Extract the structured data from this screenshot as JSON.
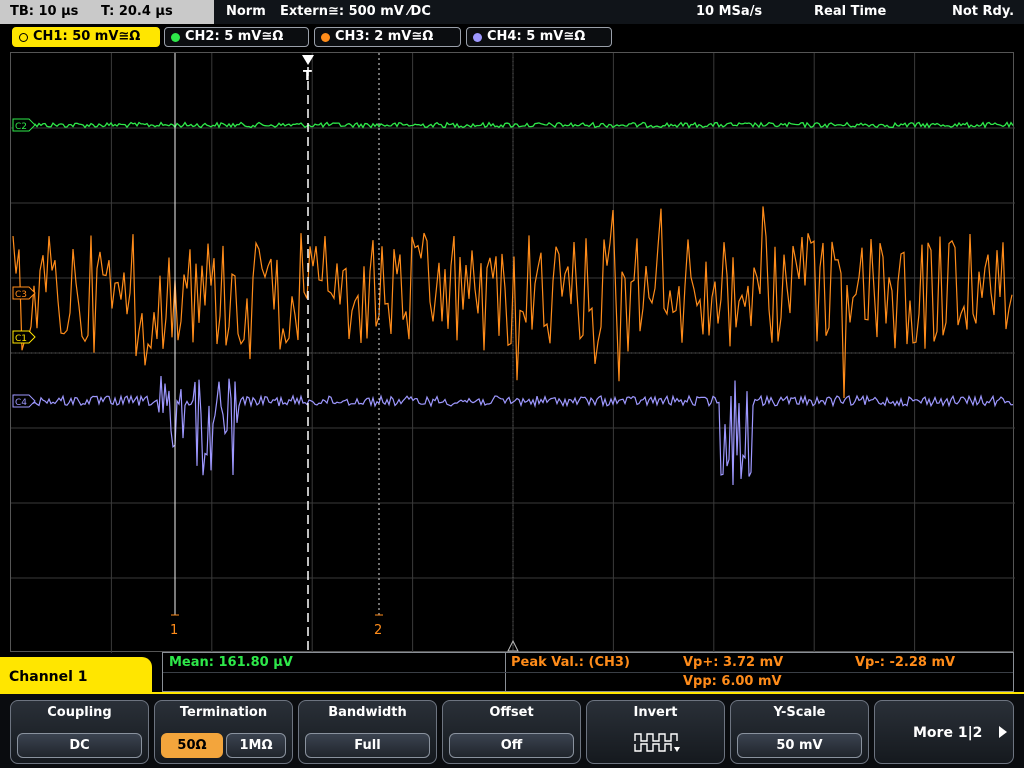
{
  "topbar": {
    "timebase": "TB: 10 µs",
    "trigger_time": "T: 20.4 µs",
    "mode": "Norm",
    "trigger_source": "Extern≅: 500 mV ⁄DC",
    "sample_rate": "10 MSa/s",
    "acq_mode": "Real Time",
    "status": "Not Rdy."
  },
  "channels": [
    {
      "label": "CH1: 50 mV≅Ω",
      "color": "#ffe600",
      "active": true
    },
    {
      "label": "CH2: 5 mV≅Ω",
      "color": "#2ee84a",
      "active": false
    },
    {
      "label": "CH3: 2 mV≅Ω",
      "color": "#ff8c1a",
      "active": false
    },
    {
      "label": "CH4: 5 mV≅Ω",
      "color": "#9e98ff",
      "active": false
    }
  ],
  "markers": {
    "ch2": "C2",
    "ch3": "C3",
    "ch1": "C1",
    "ch4": "C4",
    "trigger": "T",
    "cursor1": "1",
    "cursor2": "2"
  },
  "measurements": {
    "mean": "Mean: 161.80 µV",
    "peak_label": "Peak Val.:  (CH3)",
    "vp_plus": "Vp+: 3.72 mV",
    "vp_minus": "Vp-: -2.28 mV",
    "vpp": "Vpp: 6.00 mV"
  },
  "menu": {
    "channel_title": "Channel 1",
    "coupling": {
      "title": "Coupling",
      "value": "DC"
    },
    "termination": {
      "title": "Termination",
      "opt1": "50Ω",
      "opt2": "1MΩ",
      "selected": "50Ω"
    },
    "bandwidth": {
      "title": "Bandwidth",
      "value": "Full"
    },
    "offset": {
      "title": "Offset",
      "value": "Off"
    },
    "invert": {
      "title": "Invert",
      "icon": "pulse-wave-icon"
    },
    "yscale": {
      "title": "Y-Scale",
      "value": "50 mV"
    },
    "more": "More 1|2"
  },
  "colors": {
    "ch1": "#ffe600",
    "ch2": "#2ee84a",
    "ch3": "#ff8c1a",
    "ch4": "#9e98ff",
    "accent": "#ffe600"
  }
}
